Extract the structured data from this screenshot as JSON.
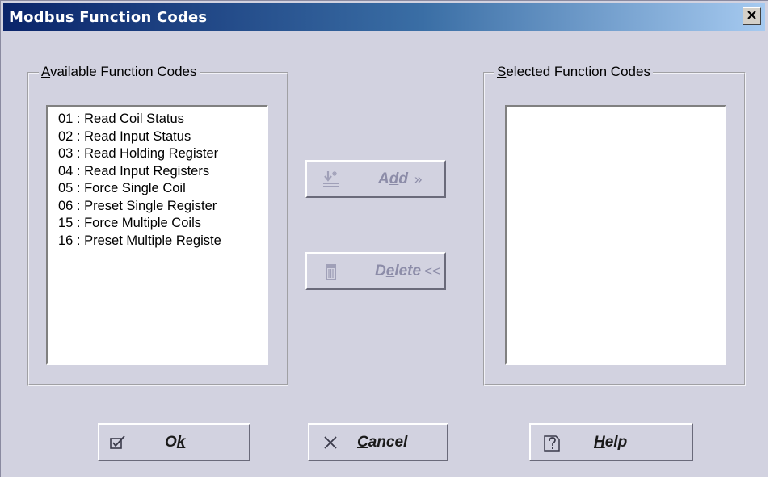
{
  "window": {
    "title": "Modbus Function Codes"
  },
  "available": {
    "label_accel": "A",
    "label_rest": "vailable Function Codes",
    "items": [
      "01 : Read Coil Status",
      "02 : Read Input Status",
      "03 : Read Holding Register",
      "04 : Read Input Registers",
      "05 : Force Single Coil",
      "06 : Preset Single Register",
      "15 : Force Multiple Coils",
      "16 : Preset Multiple Registe"
    ]
  },
  "selected": {
    "label_accel": "S",
    "label_rest": "elected Function Codes",
    "items": []
  },
  "buttons": {
    "add": {
      "pre": "A",
      "accel": "d",
      "post": "d",
      "arrows": "»",
      "icon": "add-icon",
      "enabled": false
    },
    "delete": {
      "pre": "D",
      "accel": "e",
      "post": "lete",
      "arrows": "<<",
      "icon": "trash-icon",
      "enabled": false
    },
    "ok": {
      "pre": "O",
      "accel": "k",
      "post": "",
      "icon": "check-icon"
    },
    "cancel": {
      "pre": "",
      "accel": "C",
      "post": "ancel",
      "icon": "x-icon"
    },
    "help": {
      "pre": "",
      "accel": "H",
      "post": "elp",
      "icon": "help-icon"
    }
  },
  "colors": {
    "dialog_bg": "#d2d2e0",
    "title_start": "#0a246a",
    "title_end": "#a6caf0",
    "disabled_text": "#8c8ca8"
  }
}
